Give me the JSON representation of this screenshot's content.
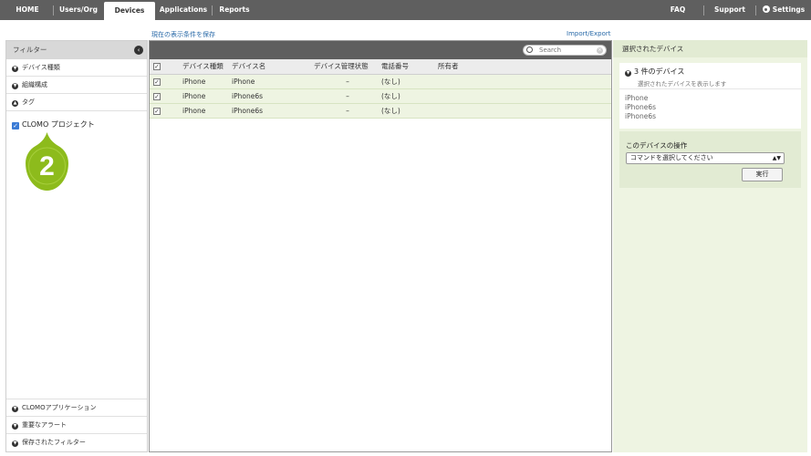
{
  "nav": {
    "home": "HOME",
    "users": "Users/Org",
    "devices": "Devices",
    "applications": "Applications",
    "reports": "Reports",
    "faq": "FAQ",
    "support": "Support",
    "settings": "Settings"
  },
  "subbar": {
    "save_view": "現在の表示条件を保存",
    "import_export": "Import/Export"
  },
  "filter": {
    "title": "フィルター",
    "items": [
      "デバイス種類",
      "組織構成",
      "タグ"
    ],
    "project": "CLOMO プロジェクト",
    "bottom_items": [
      "CLOMOアプリケーション",
      "重要なアラート",
      "保存されたフィルター"
    ]
  },
  "callout": {
    "number": "2"
  },
  "search": {
    "placeholder": "Search"
  },
  "table": {
    "headers": [
      "デバイス種類",
      "デバイス名",
      "デバイス管理状態",
      "電話番号",
      "所有者"
    ],
    "rows": [
      [
        "iPhone",
        "iPhone",
        "–",
        "(なし)",
        ""
      ],
      [
        "iPhone",
        "iPhone6s",
        "–",
        "(なし)",
        ""
      ],
      [
        "iPhone",
        "iPhone6s",
        "–",
        "(なし)",
        ""
      ]
    ]
  },
  "right": {
    "title": "選択されたデバイス",
    "count": "3 件のデバイス",
    "show_link": "選択されたデバイスを表示します",
    "devices": [
      "iPhone",
      "iPhone6s",
      "iPhone6s"
    ],
    "operation_title": "このデバイスの操作",
    "select_value": "コマンドを選択してください",
    "execute": "実行"
  },
  "colors": {
    "nav_bg": "#5f5f5f",
    "selected_row": "#eef4e2",
    "callout_green": "#8dbb1c",
    "link": "#2a6aa8"
  }
}
